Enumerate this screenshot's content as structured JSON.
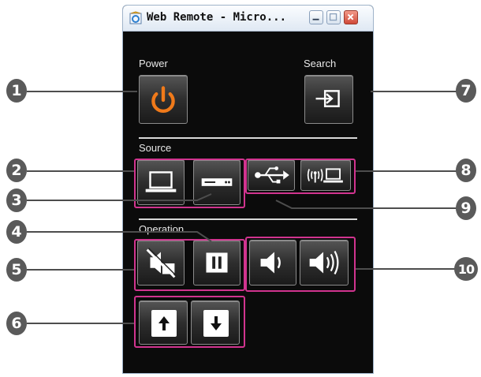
{
  "window": {
    "title": "Web Remote - Micro...",
    "title_buttons": [
      "minimize-icon",
      "maximize-icon",
      "close-icon"
    ]
  },
  "sections": {
    "power_label": "Power",
    "search_label": "Search",
    "source_label": "Source",
    "operation_label": "Operation"
  },
  "buttons": {
    "power": "power-icon",
    "search": "source-search-icon",
    "source_computer": "computer-icon",
    "source_video": "video-player-icon",
    "source_usb": "usb-icon",
    "source_network": "wireless-network-icon",
    "av_mute": "av-mute-icon",
    "freeze": "pause-icon",
    "volume_down": "volume-down-icon",
    "volume_up": "volume-up-icon",
    "page_up": "arrow-up-icon",
    "page_down": "arrow-down-icon"
  },
  "callouts": [
    "1",
    "2",
    "3",
    "4",
    "5",
    "6",
    "7",
    "8",
    "9",
    "10"
  ],
  "colors": {
    "power_icon": "#f07a1a",
    "highlight": "#d1348f",
    "badge": "#5a5a5a"
  }
}
